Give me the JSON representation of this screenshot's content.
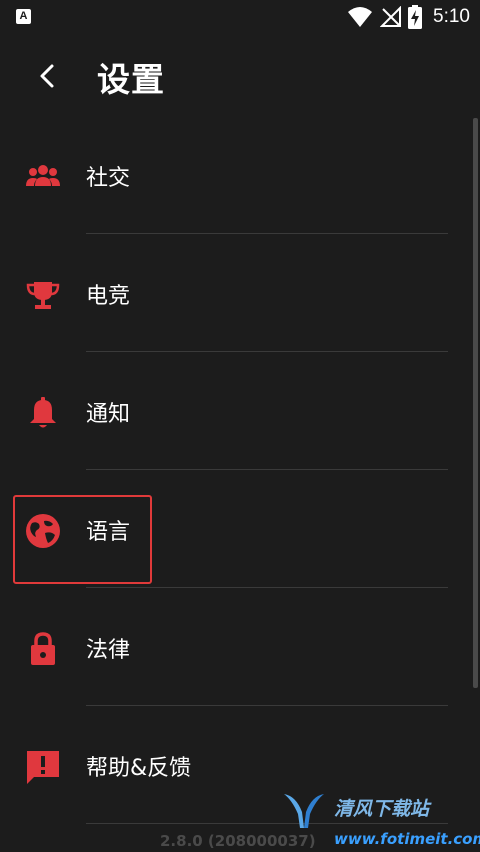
{
  "status_bar": {
    "app_icon_letter": "A",
    "time": "5:10",
    "icons": [
      "wifi-icon",
      "no-signal-icon",
      "battery-charging-icon"
    ]
  },
  "header": {
    "back_icon": "chevron-left-icon",
    "title": "设置"
  },
  "settings": {
    "items": [
      {
        "label": "社交",
        "icon": "people-icon"
      },
      {
        "label": "电竞",
        "icon": "trophy-icon"
      },
      {
        "label": "通知",
        "icon": "bell-icon"
      },
      {
        "label": "语言",
        "icon": "globe-icon",
        "highlighted": true
      },
      {
        "label": "法律",
        "icon": "lock-icon"
      },
      {
        "label": "帮助&反馈",
        "icon": "feedback-icon"
      }
    ]
  },
  "footer": {
    "version": "2.8.0 (208000037)"
  },
  "watermark": {
    "name": "清风下载站",
    "url": "www.fotimeit.com"
  },
  "colors": {
    "background": "#1c1c1c",
    "accent_red": "#e0383e",
    "text": "#ffffff",
    "divider": "#3a3a3a"
  }
}
